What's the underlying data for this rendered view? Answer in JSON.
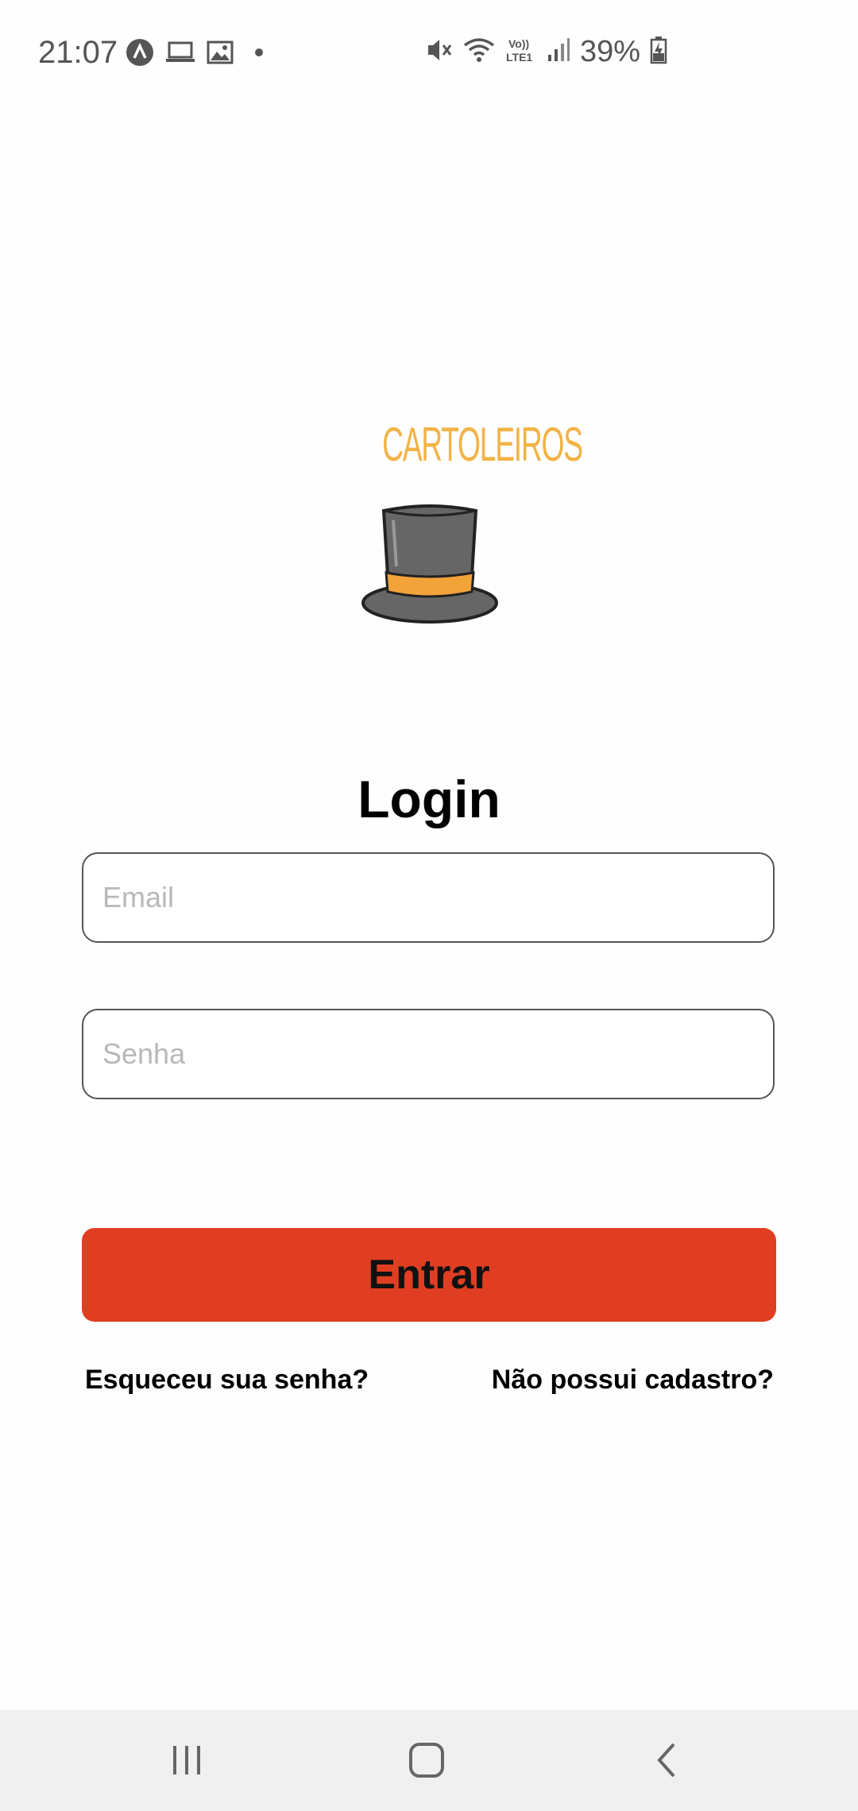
{
  "status_bar": {
    "time": "21:07",
    "battery": "39%",
    "left_icons": [
      "app-a-icon",
      "laptop-icon",
      "image-icon",
      "dot-icon"
    ],
    "right_icons": [
      "mute-icon",
      "wifi-icon",
      "volte-icon",
      "signal-icon",
      "battery-charging-icon"
    ]
  },
  "logo": {
    "brand": "CARTOLEIROS",
    "icon": "top-hat-icon",
    "colors": {
      "brand": "#f2b346",
      "hat": "#666666",
      "band": "#f2a33a"
    }
  },
  "page": {
    "title": "Login"
  },
  "form": {
    "email_placeholder": "Email",
    "email_value": "",
    "password_placeholder": "Senha",
    "password_value": "",
    "submit_label": "Entrar"
  },
  "links": {
    "forgot": "Esqueceu sua senha?",
    "signup": "Não possui cadastro?"
  },
  "nav": {
    "items": [
      "recent-apps-icon",
      "home-icon",
      "back-icon"
    ]
  },
  "colors": {
    "accent": "#e03e22",
    "background": "#fefefe",
    "nav_bar": "#f0f0f0"
  }
}
